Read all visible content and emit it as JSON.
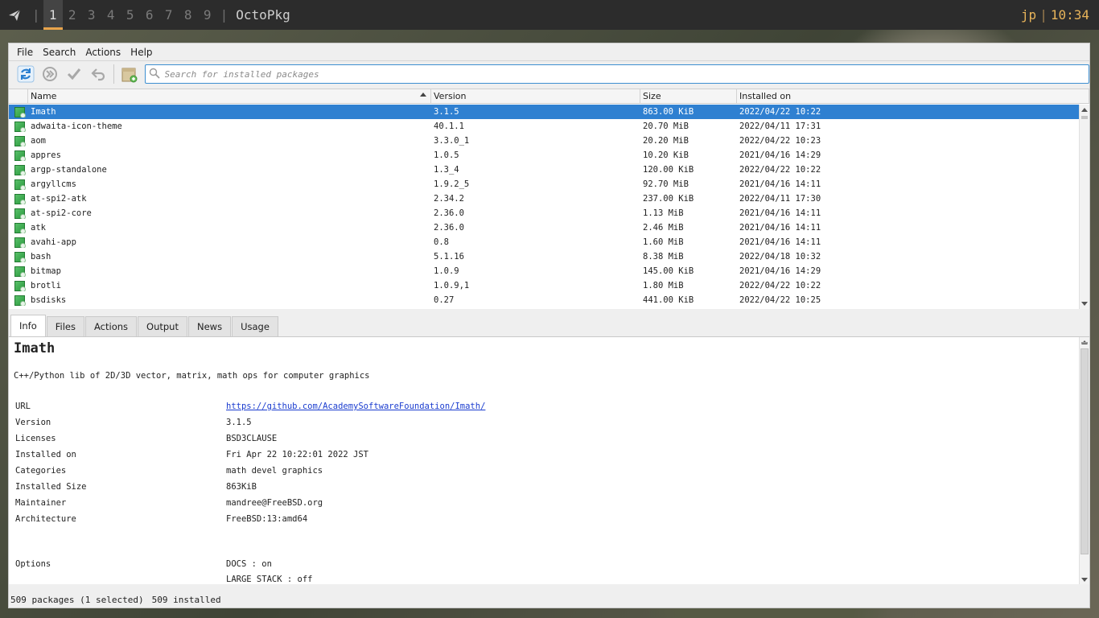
{
  "topbar": {
    "launcher_icon": "paper-plane-icon",
    "workspaces": [
      "1",
      "2",
      "3",
      "4",
      "5",
      "6",
      "7",
      "8",
      "9"
    ],
    "active_workspace": "1",
    "window_title": "OctoPkg",
    "user": "jp",
    "clock": "10:34",
    "accent": "#e8a44c"
  },
  "menubar": {
    "file": "File",
    "search": "Search",
    "actions": "Actions",
    "help": "Help"
  },
  "toolbar": {
    "icons": [
      "sync-database-icon",
      "upgrade-icon",
      "commit-icon",
      "rollback-icon",
      "install-local-package-icon"
    ],
    "search_placeholder": "Search for installed packages",
    "search_value": ""
  },
  "package_list": {
    "columns": [
      "Name",
      "Version",
      "Size",
      "Installed on"
    ],
    "sorted_by": "Name",
    "selected_color": "#2f80d1",
    "rows": [
      {
        "name": "Imath",
        "version": "3.1.5",
        "size": "863.00 KiB",
        "installed": "2022/04/22 10:22"
      },
      {
        "name": "adwaita-icon-theme",
        "version": "40.1.1",
        "size": "20.70 MiB",
        "installed": "2022/04/11 17:31"
      },
      {
        "name": "aom",
        "version": "3.3.0_1",
        "size": "20.20 MiB",
        "installed": "2022/04/22 10:23"
      },
      {
        "name": "appres",
        "version": "1.0.5",
        "size": "10.20 KiB",
        "installed": "2021/04/16 14:29"
      },
      {
        "name": "argp-standalone",
        "version": "1.3_4",
        "size": "120.00 KiB",
        "installed": "2022/04/22 10:22"
      },
      {
        "name": "argyllcms",
        "version": "1.9.2_5",
        "size": "92.70 MiB",
        "installed": "2021/04/16 14:11"
      },
      {
        "name": "at-spi2-atk",
        "version": "2.34.2",
        "size": "237.00 KiB",
        "installed": "2022/04/11 17:30"
      },
      {
        "name": "at-spi2-core",
        "version": "2.36.0",
        "size": "1.13 MiB",
        "installed": "2021/04/16 14:11"
      },
      {
        "name": "atk",
        "version": "2.36.0",
        "size": "2.46 MiB",
        "installed": "2021/04/16 14:11"
      },
      {
        "name": "avahi-app",
        "version": "0.8",
        "size": "1.60 MiB",
        "installed": "2021/04/16 14:11"
      },
      {
        "name": "bash",
        "version": "5.1.16",
        "size": "8.38 MiB",
        "installed": "2022/04/18 10:32"
      },
      {
        "name": "bitmap",
        "version": "1.0.9",
        "size": "145.00 KiB",
        "installed": "2021/04/16 14:29"
      },
      {
        "name": "brotli",
        "version": "1.0.9,1",
        "size": "1.80 MiB",
        "installed": "2022/04/22 10:22"
      },
      {
        "name": "bsdisks",
        "version": "0.27",
        "size": "441.00 KiB",
        "installed": "2022/04/22 10:25"
      }
    ]
  },
  "tabs": [
    "Info",
    "Files",
    "Actions",
    "Output",
    "News",
    "Usage"
  ],
  "active_tab": "Info",
  "info": {
    "title": "Imath",
    "description": "C++/Python lib of 2D/3D vector, matrix, math ops for computer graphics",
    "fields": [
      {
        "key": "URL",
        "value": "https://github.com/AcademySoftwareFoundation/Imath/",
        "link": true
      },
      {
        "key": "Version",
        "value": "3.1.5"
      },
      {
        "key": "Licenses",
        "value": "BSD3CLAUSE"
      },
      {
        "key": "Installed on",
        "value": "Fri Apr 22 10:22:01 2022 JST"
      },
      {
        "key": "Categories",
        "value": "math devel graphics"
      },
      {
        "key": "Installed Size",
        "value": "863KiB"
      },
      {
        "key": "Maintainer",
        "value": "mandree@FreeBSD.org"
      },
      {
        "key": "Architecture",
        "value": "FreeBSD:13:amd64"
      }
    ],
    "options_label": "Options",
    "options": [
      "DOCS : on",
      "LARGE STACK : off"
    ]
  },
  "statusbar": {
    "packages": "509 packages (1 selected)",
    "installed": "509 installed"
  }
}
